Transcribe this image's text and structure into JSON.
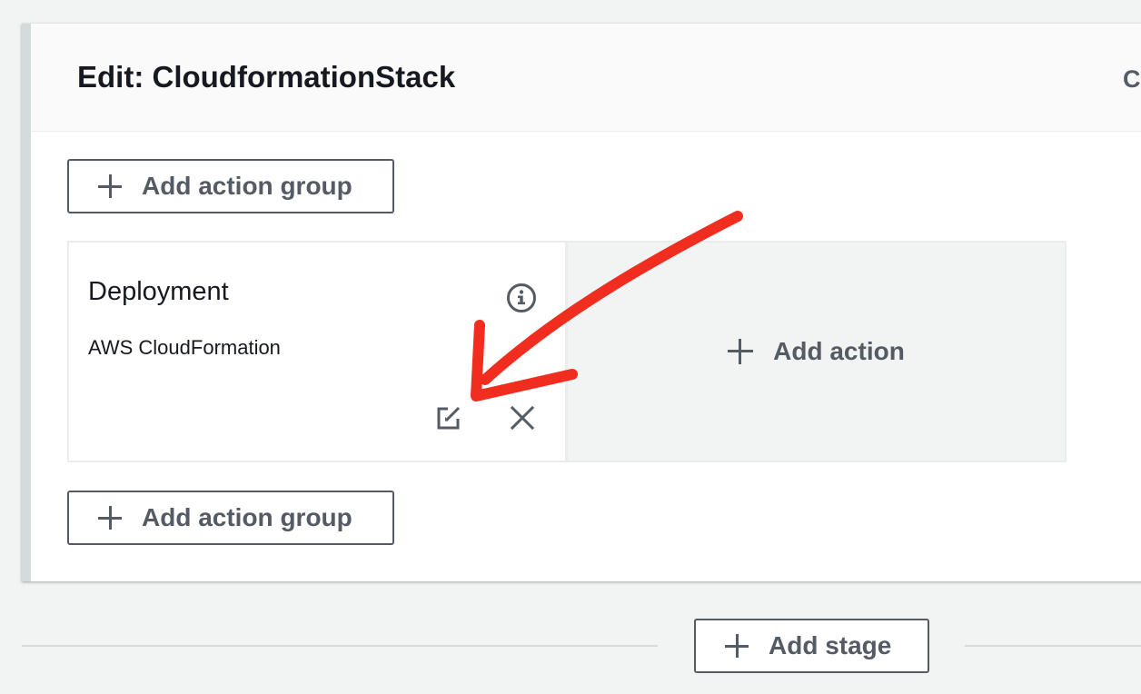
{
  "panel": {
    "title": "Edit: CloudformationStack",
    "cancel_label": "Ca"
  },
  "action_groups": {
    "add_group_top_label": "Add action group",
    "add_group_bottom_label": "Add action group"
  },
  "action": {
    "name": "Deployment",
    "provider": "AWS CloudFormation",
    "info_icon": "info-icon",
    "edit_icon": "edit-icon",
    "remove_icon": "close-icon"
  },
  "add_action_label": "Add action",
  "add_stage_label": "Add stage",
  "colors": {
    "annotation_arrow": "#f02d1f",
    "button_text": "#545b64",
    "page_background": "#f2f3f3"
  }
}
